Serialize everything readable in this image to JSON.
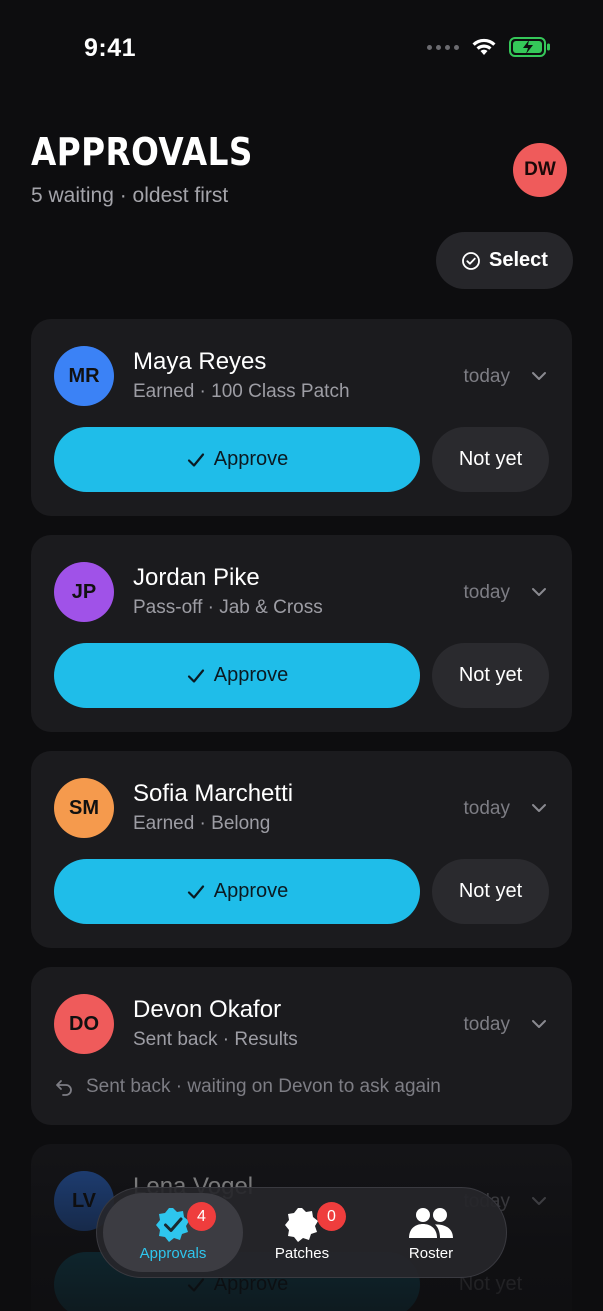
{
  "status_bar": {
    "time": "9:41"
  },
  "header": {
    "title": "APPROVALS",
    "subtitle": "5 waiting · oldest first",
    "user_initials": "DW"
  },
  "toolbar": {
    "select_label": "Select"
  },
  "approvals": [
    {
      "initials": "MR",
      "name": "Maya Reyes",
      "meta": "Earned · 100 Class Patch",
      "when": "today",
      "approve_label": "Approve",
      "not_yet_label": "Not yet",
      "avatar_color": "#3b82f6"
    },
    {
      "initials": "JP",
      "name": "Jordan Pike",
      "meta": "Pass-off · Jab & Cross",
      "when": "today",
      "approve_label": "Approve",
      "not_yet_label": "Not yet",
      "avatar_color": "#a052e8"
    },
    {
      "initials": "SM",
      "name": "Sofia Marchetti",
      "meta": "Earned · Belong",
      "when": "today",
      "approve_label": "Approve",
      "not_yet_label": "Not yet",
      "avatar_color": "#f59a4d"
    },
    {
      "initials": "DO",
      "name": "Devon Okafor",
      "meta": "Sent back · Results",
      "when": "today",
      "note": "Sent back · waiting on Devon to ask again",
      "avatar_color": "#ef5b5b"
    },
    {
      "initials": "LV",
      "name": "Lena Vogel",
      "when": "today",
      "approve_label": "Approve",
      "not_yet_label": "Not yet",
      "avatar_color": "#2f6fd6"
    }
  ],
  "tabs": [
    {
      "label": "Approvals",
      "badge": "4",
      "icon": "check-badge-icon",
      "active": true
    },
    {
      "label": "Patches",
      "badge": "0",
      "icon": "patch-icon",
      "active": false
    },
    {
      "label": "Roster",
      "icon": "people-icon",
      "active": false
    }
  ],
  "colors": {
    "accent": "#1fbde9",
    "badge": "#ef3d3d",
    "background": "#0d0d0f",
    "card": "#1b1b1e"
  }
}
